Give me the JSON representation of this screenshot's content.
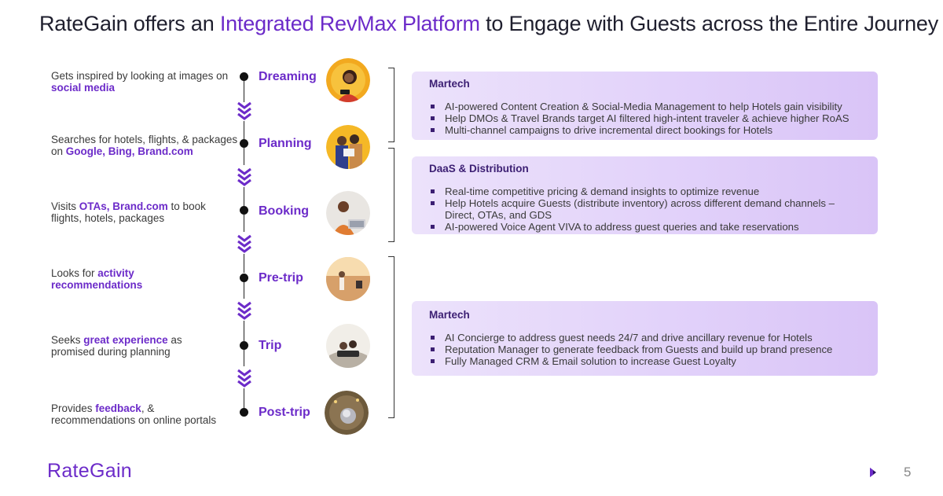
{
  "title": {
    "prefix": "RateGain offers an ",
    "accent": "Integrated RevMax Platform",
    "suffix": " to Engage with Guests across the Entire Journey"
  },
  "stages": [
    {
      "label": "Dreaming",
      "desc_pre": "Gets inspired by looking at images on ",
      "desc_bold": "social media",
      "desc_post": ""
    },
    {
      "label": "Planning",
      "desc_pre": "Searches for hotels, flights, & packages on ",
      "desc_bold": "Google, Bing, Brand.com",
      "desc_post": ""
    },
    {
      "label": "Booking",
      "desc_pre": "Visits ",
      "desc_bold": "OTAs, Brand.com",
      "desc_post": " to book flights, hotels, packages"
    },
    {
      "label": "Pre-trip",
      "desc_pre": "Looks for ",
      "desc_bold": "activity recommendations",
      "desc_post": ""
    },
    {
      "label": "Trip",
      "desc_pre": "Seeks ",
      "desc_bold": "great experience",
      "desc_post": " as promised during planning"
    },
    {
      "label": "Post-trip",
      "desc_pre": "Provides ",
      "desc_bold": "feedback",
      "desc_post": ", & recommendations on online portals"
    }
  ],
  "panels": [
    {
      "title": "Martech",
      "items": [
        "AI-powered Content Creation & Social-Media Management to help Hotels gain visibility",
        "Help DMOs & Travel Brands target AI filtered high-intent traveler & achieve higher RoAS",
        "Multi-channel campaigns to drive incremental direct bookings for Hotels"
      ]
    },
    {
      "title": "DaaS & Distribution",
      "items": [
        "Real-time competitive pricing & demand insights to optimize revenue",
        "Help Hotels acquire Guests (distribute inventory) across different demand channels – Direct, OTAs, and GDS",
        "AI-powered Voice Agent VIVA to address guest queries and take reservations"
      ]
    },
    {
      "title": "Martech",
      "items": [
        "AI Concierge to address guest needs 24/7 and drive ancillary revenue for Hotels",
        "Reputation Manager to generate feedback from Guests and build up brand presence",
        "Fully Managed CRM & Email solution to increase Guest Loyalty"
      ]
    }
  ],
  "footer": {
    "logo": "RateGain",
    "page_number": "5"
  },
  "colors": {
    "accent": "#6c2bc9",
    "panel_bg": "#e2d2fa",
    "panel_title": "#3c1f73"
  }
}
